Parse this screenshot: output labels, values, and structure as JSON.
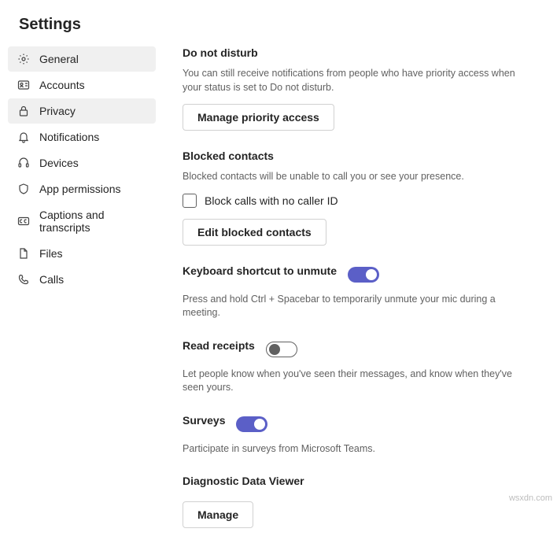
{
  "page_title": "Settings",
  "sidebar": {
    "items": [
      {
        "label": "General"
      },
      {
        "label": "Accounts"
      },
      {
        "label": "Privacy"
      },
      {
        "label": "Notifications"
      },
      {
        "label": "Devices"
      },
      {
        "label": "App permissions"
      },
      {
        "label": "Captions and transcripts"
      },
      {
        "label": "Files"
      },
      {
        "label": "Calls"
      }
    ]
  },
  "sections": {
    "dnd": {
      "title": "Do not disturb",
      "desc": "You can still receive notifications from people who have priority access when your status is set to Do not disturb.",
      "button": "Manage priority access"
    },
    "blocked": {
      "title": "Blocked contacts",
      "desc": "Blocked contacts will be unable to call you or see your presence.",
      "checkbox_label": "Block calls with no caller ID",
      "checkbox_checked": false,
      "button": "Edit blocked contacts"
    },
    "unmute": {
      "title": "Keyboard shortcut to unmute",
      "desc": "Press and hold Ctrl + Spacebar to temporarily unmute your mic during a meeting.",
      "toggle": true
    },
    "read_receipts": {
      "title": "Read receipts",
      "desc": "Let people know when you've seen their messages, and know when they've seen yours.",
      "toggle": false
    },
    "surveys": {
      "title": "Surveys",
      "desc": "Participate in surveys from Microsoft Teams.",
      "toggle": true
    },
    "diag": {
      "title": "Diagnostic Data Viewer",
      "button": "Manage"
    }
  },
  "watermark": "wsxdn.com"
}
